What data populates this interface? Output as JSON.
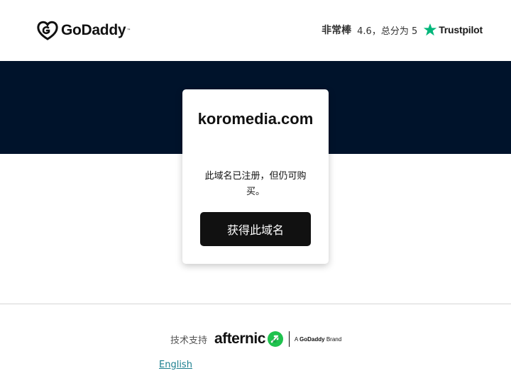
{
  "header": {
    "logo_text": "GoDaddy",
    "logo_tm": "™",
    "rating_word": "非常棒",
    "rating_detail": "4.6，总分为 5",
    "trustpilot_label": "Trustpilot",
    "trustpilot_star_color": "#00b67a"
  },
  "hero": {
    "band_color": "#00132b",
    "domain": "koromedia.com",
    "status": "此域名已注册，但仍可购买。",
    "cta_label": "获得此域名"
  },
  "footer": {
    "powered_by": "技术支持",
    "brand_name": "afternic",
    "brand_accent_color": "#1fc24e",
    "brand_tag_prefix": "A",
    "brand_tag_company": "GoDaddy",
    "brand_tag_suffix": "Brand",
    "language_link": "English"
  }
}
